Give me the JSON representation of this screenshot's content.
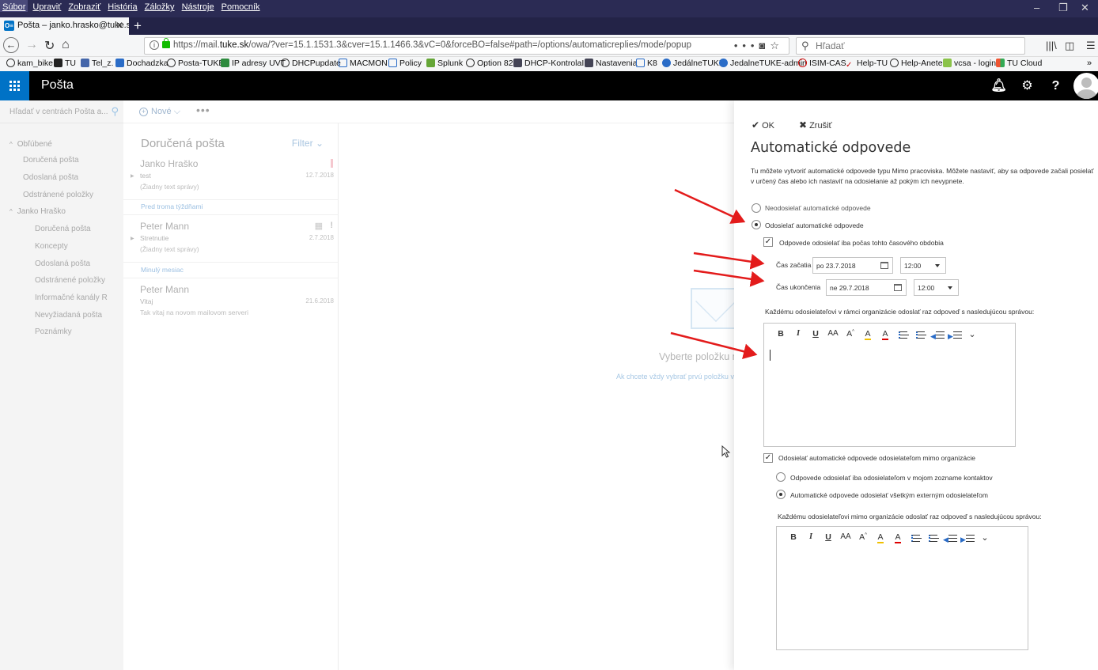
{
  "browser": {
    "menu": [
      "Súbor",
      "Upraviť",
      "Zobraziť",
      "História",
      "Záložky",
      "Nástroje",
      "Pomocník"
    ],
    "tab_title": "Pošta – janko.hrasko@tuke.sk",
    "tab_icon_text": "O≡",
    "url_prefix": "https://mail.",
    "url_host": "tuke.sk",
    "url_path": "/owa/?ver=15.1.1531.3&cver=15.1.1466.3&vC=0&forceBO=false#path=/options/automaticreplies/mode/popup",
    "search_placeholder": "Hľadať",
    "bookmarks": [
      "kam_bike",
      "TU",
      "Tel_z.",
      "Dochadzka",
      "Posta-TUKE",
      "IP adresy UVT",
      "DHCPupdate",
      "MACMON",
      "Policy",
      "Splunk",
      "Option 82",
      "DHCP-KontrolaIP",
      "Nastavenia",
      "K8",
      "JedálneTUKE",
      "JedalneTUKE-admin",
      "ISIM-CAS",
      "Help-TU",
      "Help-Anete",
      "vcsa - login",
      "TU Cloud"
    ]
  },
  "owa": {
    "app_title": "Pošta",
    "left_search_placeholder": "Hľadať v centrách Pošta a...",
    "nav": {
      "favorites_label": "Obľúbené",
      "favorites": [
        "Doručená pošta",
        "Odoslaná pošta",
        "Odstránené položky"
      ],
      "account_label": "Janko Hraško",
      "account_folders": [
        "Doručená pošta",
        "Koncepty",
        "Odoslaná pošta",
        "Odstránené položky",
        "Informačné kanály RSS",
        "Nevyžiadaná pošta",
        "Poznámky"
      ]
    },
    "cmd": {
      "new_label": "Nové",
      "more": "•••"
    },
    "list": {
      "heading": "Doručená pošta",
      "filter": "Filter",
      "group_two_weeks": "Pred troma týždňami",
      "group_last_month": "Minulý mesiac",
      "messages": [
        {
          "from": "Janko Hraško",
          "subject": "test",
          "preview": "(Žiadny text správy)",
          "date": "12.7.2018"
        },
        {
          "from": "Peter Mann",
          "subject": "Stretnutie",
          "preview": "(Žiadny text správy)",
          "date": "2.7.2018"
        },
        {
          "from": "Peter Mann",
          "subject": "Vitaj",
          "preview": "Tak vitaj na novom mailovom serveri",
          "date": "21.6.2018"
        }
      ]
    },
    "reading": {
      "select_item": "Vyberte položku na čítanie",
      "hint": "Ak chcete vždy vybrať prvú položku v zozname, kliknite sem"
    }
  },
  "panel": {
    "ok_label": "OK",
    "cancel_label": "Zrušiť",
    "title": "Automatické odpovede",
    "desc_line1": "Tu môžete vytvoriť automatické odpovede typu Mimo pracoviska. Môžete nastaviť, aby sa odpovede začali posielať",
    "desc_line2": "v určený čas alebo ich nastaviť na odosielanie až pokým ich nevypnete.",
    "no_send": "Neodosielať automatické odpovede",
    "send": "Odosielať automatické odpovede",
    "send_selected": true,
    "period_only": "Odpovede odosielať iba počas tohto časového obdobia",
    "period_checked": true,
    "start_label": "Čas začatia",
    "start_date": "po 23.7.2018",
    "start_time": "12:00",
    "end_label": "Čas ukončenia",
    "end_date": "ne 29.7.2018",
    "end_time": "12:00",
    "inside_msg_label": "Každému odosielateľovi v rámci organizácie odoslať raz odpoveď s nasledujúcou správou:",
    "outside_enable": "Odosielať automatické odpovede odosielateľom mimo organizácie",
    "outside_checked": true,
    "outside_contacts_only": "Odpovede odosielať iba odosielateľom v mojom zozname kontaktov",
    "outside_all": "Automatické odpovede odosielať všetkým externým odosielateľom",
    "outside_all_selected": true,
    "outside_msg_label": "Každému odosielateľovi mimo organizácie odoslať raz odpoveď s nasledujúcou správou:",
    "toolbar": {
      "bold": "B",
      "italic": "I",
      "underline": "U",
      "font_size": "AA",
      "grow": "A",
      "highlight": "A",
      "font_color": "A",
      "more": "⌄"
    }
  },
  "colors": {
    "owa_blue": "#0072c6",
    "arrow_red": "#e31b1b",
    "firefox_dark": "#2b2b54"
  }
}
